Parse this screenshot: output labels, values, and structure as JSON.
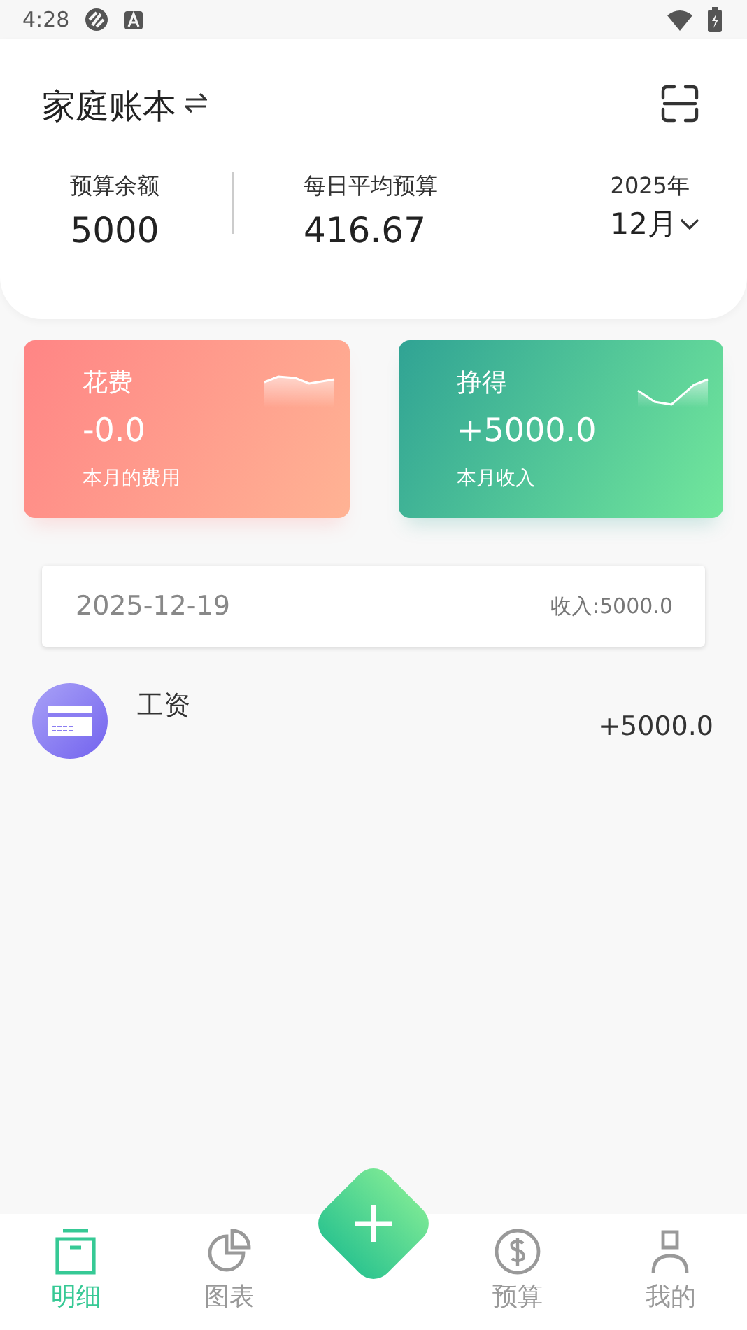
{
  "status_bar": {
    "time": "4:28"
  },
  "header": {
    "title": "家庭账本",
    "budget_label": "预算余额",
    "budget_value": "5000",
    "daily_label": "每日平均预算",
    "daily_value": "416.67",
    "year": "2025年",
    "month": "12月"
  },
  "cards": [
    {
      "kind": "expense",
      "title": "花费",
      "amount": "-0.0",
      "caption": "本月的费用"
    },
    {
      "kind": "income",
      "title": "挣得",
      "amount": "+5000.0",
      "caption": "本月收入"
    }
  ],
  "days": [
    {
      "date": "2025-12-19",
      "summary": "收入:5000.0",
      "entries": [
        {
          "name": "工资",
          "amount": "+5000.0"
        }
      ]
    }
  ],
  "tabs": [
    {
      "kind": "list",
      "label": "明细",
      "selected": true
    },
    {
      "kind": "chart",
      "label": "图表",
      "selected": false
    },
    {
      "kind": "add"
    },
    {
      "kind": "budget",
      "label": "预算",
      "selected": false
    },
    {
      "kind": "me",
      "label": "我的",
      "selected": false
    }
  ]
}
